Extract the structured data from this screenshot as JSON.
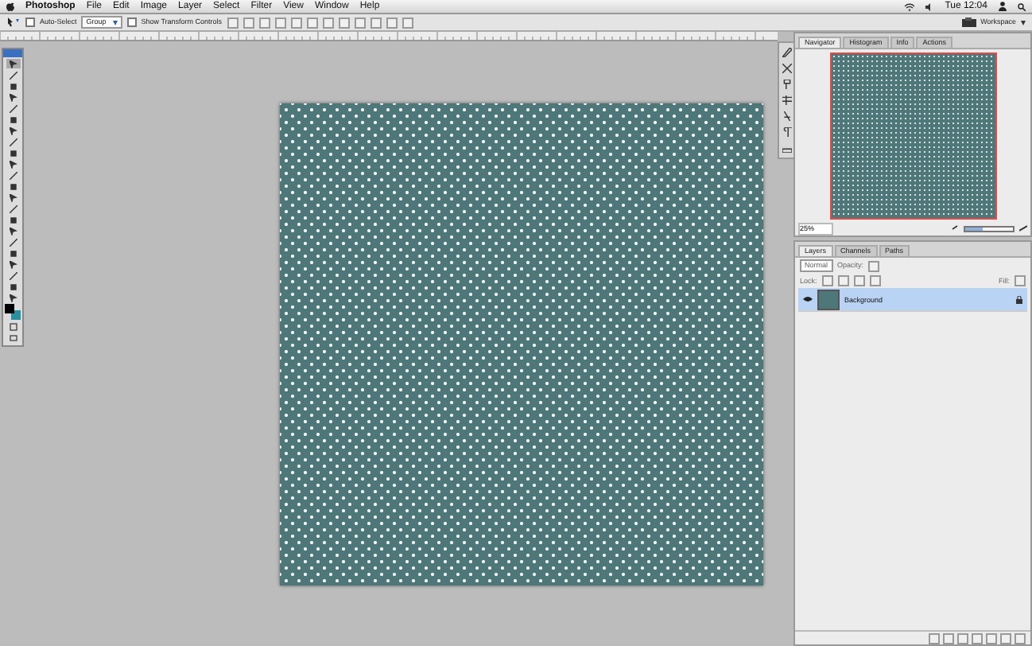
{
  "menu_bar": {
    "app": "Photoshop",
    "items": [
      "File",
      "Edit",
      "Image",
      "Layer",
      "Select",
      "Filter",
      "View",
      "Window",
      "Help"
    ],
    "clock": "Tue 12:04"
  },
  "options_bar": {
    "auto_select": {
      "label": "Auto-Select",
      "checked": false
    },
    "target": "Group",
    "show_transform": {
      "label": "Show Transform Controls",
      "checked": false
    },
    "workspace": "Workspace"
  },
  "navigator": {
    "tabs": [
      {
        "label": "Navigator",
        "selected": true
      },
      {
        "label": "Histogram",
        "selected": false
      },
      {
        "label": "Info",
        "selected": false
      },
      {
        "label": "Actions",
        "selected": false
      }
    ],
    "zoom": "25%",
    "zoom_level": {
      "level": 0.35
    }
  },
  "layers": {
    "tabs": [
      {
        "label": "Layers",
        "selected": true
      },
      {
        "label": "Channels",
        "selected": false
      },
      {
        "label": "Paths",
        "selected": false
      }
    ],
    "blend_mode": "Normal",
    "opacity_label": "Opacity:",
    "lock_label": "Lock:",
    "fill_label": "Fill:",
    "items": [
      {
        "name": "Background",
        "visible": true,
        "selected": true
      }
    ]
  }
}
